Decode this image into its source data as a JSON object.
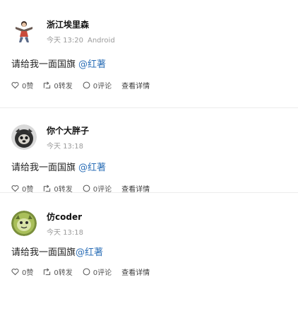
{
  "posts": [
    {
      "username": "浙江埃里森",
      "time": "今天 13:20",
      "source": "Android",
      "content_text": "请给我一面国旗",
      "mention": "@红著",
      "actions": {
        "like": "0赞",
        "forward": "0转发",
        "comment": "0评论",
        "detail": "查看详情"
      },
      "avatar_icon": "dancer-avatar-icon"
    },
    {
      "username": "你个大胖子",
      "time": "今天 13:18",
      "source": "",
      "content_text": "请给我一面国旗",
      "mention": "@红著",
      "actions": {
        "like": "0赞",
        "forward": "0转发",
        "comment": "0评论",
        "detail": "查看详情"
      },
      "avatar_icon": "dog-avatar-icon"
    },
    {
      "username": "仿coder",
      "time": "今天 13:18",
      "source": "",
      "content_text": "请给我一面国旗",
      "mention": "@红著",
      "actions": {
        "like": "0赞",
        "forward": "0转发",
        "comment": "0评论",
        "detail": "查看详情"
      },
      "avatar_icon": "creature-avatar-icon"
    }
  ],
  "colors": {
    "mention": "#2c6fb7",
    "meta": "#9a9a9a",
    "divider": "#ececec"
  }
}
